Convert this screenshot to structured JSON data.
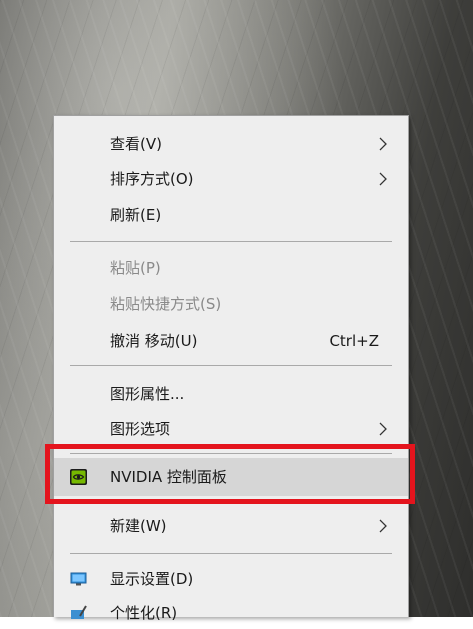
{
  "context_menu": {
    "items": {
      "view": {
        "label": "查看(V)"
      },
      "sort": {
        "label": "排序方式(O)"
      },
      "refresh": {
        "label": "刷新(E)"
      },
      "paste": {
        "label": "粘贴(P)"
      },
      "paste_shortcut": {
        "label": "粘贴快捷方式(S)"
      },
      "undo_move": {
        "label": "撤消 移动(U)",
        "shortcut": "Ctrl+Z"
      },
      "graphics_properties": {
        "label": "图形属性..."
      },
      "graphics_options": {
        "label": "图形选项"
      },
      "nvidia_panel": {
        "label": "NVIDIA 控制面板",
        "icon": "nvidia-logo-icon"
      },
      "new": {
        "label": "新建(W)"
      },
      "display_settings": {
        "label": "显示设置(D)",
        "icon": "monitor-icon"
      },
      "personalize": {
        "label": "个性化(R)",
        "icon": "personalize-icon"
      }
    }
  },
  "highlight_color": "#e4141d",
  "accent_green": "#76b900"
}
